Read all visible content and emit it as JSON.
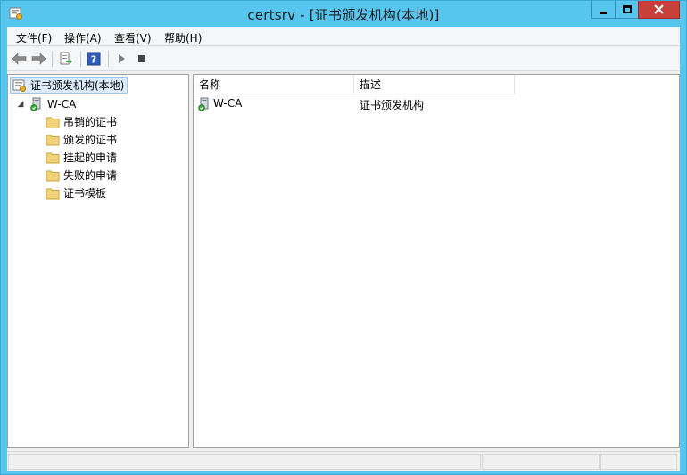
{
  "window": {
    "title": "certsrv - [证书颁发机构(本地)]"
  },
  "menu": {
    "items": [
      {
        "label": "文件(F)"
      },
      {
        "label": "操作(A)"
      },
      {
        "label": "查看(V)"
      },
      {
        "label": "帮助(H)"
      }
    ]
  },
  "toolbar": {
    "buttons": [
      {
        "icon": "back-arrow-icon"
      },
      {
        "icon": "forward-arrow-icon"
      },
      {
        "icon": "export-list-icon"
      },
      {
        "icon": "help-icon"
      },
      {
        "icon": "start-service-icon"
      },
      {
        "icon": "stop-service-icon"
      }
    ]
  },
  "tree": {
    "root": {
      "label": "证书颁发机构(本地)",
      "icon": "certificate-authority-icon"
    },
    "ca": {
      "label": "W-CA",
      "icon": "ca-server-icon",
      "expanded": true
    },
    "children": [
      {
        "label": "吊销的证书",
        "icon": "folder-icon"
      },
      {
        "label": "颁发的证书",
        "icon": "folder-icon"
      },
      {
        "label": "挂起的申请",
        "icon": "folder-icon"
      },
      {
        "label": "失败的申请",
        "icon": "folder-icon"
      },
      {
        "label": "证书模板",
        "icon": "folder-icon"
      }
    ]
  },
  "list": {
    "columns": [
      {
        "label": "名称"
      },
      {
        "label": "描述"
      }
    ],
    "rows": [
      {
        "name": "W-CA",
        "description": "证书颁发机构",
        "icon": "ca-server-icon"
      }
    ]
  },
  "colors": {
    "titlebar": "#57c6ee",
    "close_button": "#c7413a",
    "selection": "#dcecfc",
    "folder": "#f3d37a"
  }
}
